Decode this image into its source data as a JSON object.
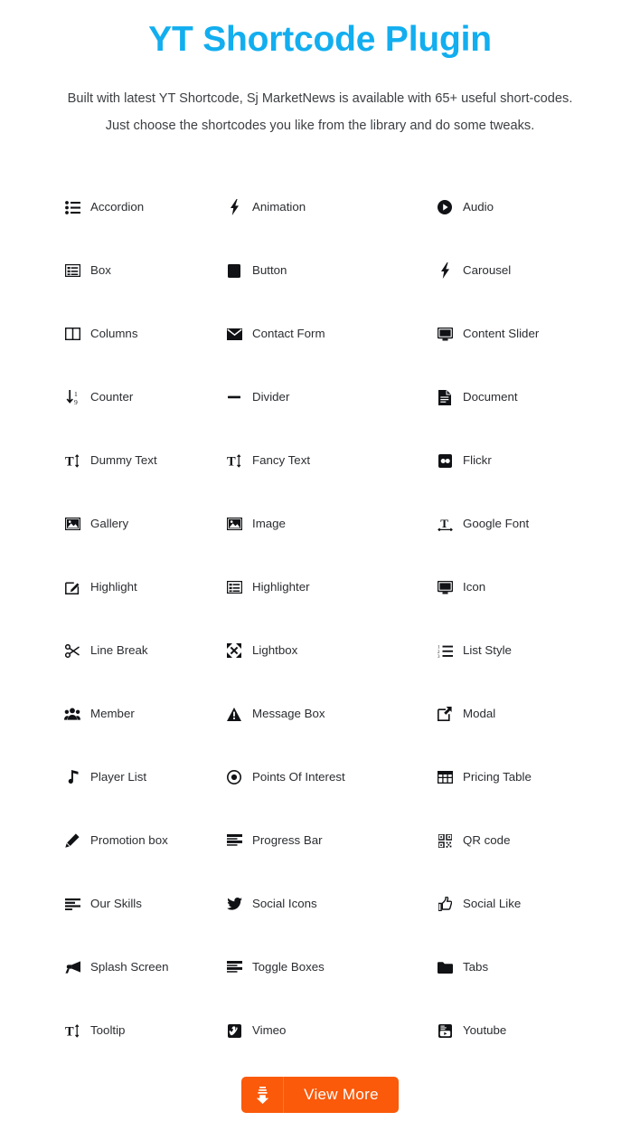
{
  "header": {
    "title": "YT Shortcode Plugin",
    "subtitle": "Built with latest YT Shortcode, Sj MarketNews is available with 65+ useful short-codes.  Just choose the shortcodes you like from the library and do some tweaks.",
    "title_color": "#12AEEF",
    "subtitle_color": "#3d4044"
  },
  "shortcodes": {
    "rows": [
      [
        {
          "label": "Accordion",
          "icon": "list-ul-icon"
        },
        {
          "label": "Animation",
          "icon": "bolt-icon"
        },
        {
          "label": "Audio",
          "icon": "play-circle-icon"
        }
      ],
      [
        {
          "label": "Box",
          "icon": "list-alt-icon"
        },
        {
          "label": "Button",
          "icon": "square-filled-icon"
        },
        {
          "label": "Carousel",
          "icon": "bolt-icon"
        }
      ],
      [
        {
          "label": "Columns",
          "icon": "columns-icon"
        },
        {
          "label": "Contact Form",
          "icon": "envelope-icon"
        },
        {
          "label": "Content Slider",
          "icon": "desktop-icon"
        }
      ],
      [
        {
          "label": "Counter",
          "icon": "sort-numeric-icon"
        },
        {
          "label": "Divider",
          "icon": "minus-icon"
        },
        {
          "label": "Document",
          "icon": "file-text-icon"
        }
      ],
      [
        {
          "label": "Dummy Text",
          "icon": "text-height-icon"
        },
        {
          "label": "Fancy Text",
          "icon": "text-height-icon"
        },
        {
          "label": "Flickr",
          "icon": "flickr-icon"
        }
      ],
      [
        {
          "label": "Gallery",
          "icon": "picture-icon"
        },
        {
          "label": "Image",
          "icon": "picture-icon"
        },
        {
          "label": "Google Font",
          "icon": "text-width-icon"
        }
      ],
      [
        {
          "label": "Highlight",
          "icon": "pencil-square-icon"
        },
        {
          "label": "Highlighter",
          "icon": "list-alt-icon"
        },
        {
          "label": "Icon",
          "icon": "desktop-icon"
        }
      ],
      [
        {
          "label": "Line Break",
          "icon": "scissors-icon"
        },
        {
          "label": "Lightbox",
          "icon": "expand-arrows-icon"
        },
        {
          "label": "List Style",
          "icon": "list-ol-icon"
        }
      ],
      [
        {
          "label": "Member",
          "icon": "group-icon"
        },
        {
          "label": "Message Box",
          "icon": "warning-triangle-icon"
        },
        {
          "label": "Modal",
          "icon": "external-link-icon"
        }
      ],
      [
        {
          "label": "Player List",
          "icon": "music-note-icon"
        },
        {
          "label": "Points Of Interest",
          "icon": "dot-circle-icon"
        },
        {
          "label": "Pricing Table",
          "icon": "table-icon"
        }
      ],
      [
        {
          "label": "Promotion box",
          "icon": "pencil-icon"
        },
        {
          "label": "Progress Bar",
          "icon": "tasks-icon"
        },
        {
          "label": "QR code",
          "icon": "qrcode-icon"
        }
      ],
      [
        {
          "label": "Our Skills",
          "icon": "align-left-icon"
        },
        {
          "label": "Social Icons",
          "icon": "twitter-icon"
        },
        {
          "label": "Social Like",
          "icon": "thumbs-up-icon"
        }
      ],
      [
        {
          "label": "Splash Screen",
          "icon": "bullhorn-icon"
        },
        {
          "label": "Toggle Boxes",
          "icon": "tasks-icon"
        },
        {
          "label": "Tabs",
          "icon": "folder-icon"
        }
      ],
      [
        {
          "label": "Tooltip",
          "icon": "text-height-icon"
        },
        {
          "label": "Vimeo",
          "icon": "vimeo-icon"
        },
        {
          "label": "Youtube",
          "icon": "youtube-icon"
        }
      ]
    ]
  },
  "view_more": {
    "label": "View More",
    "icon": "download-arrow-icon",
    "background_color": "#FA5A0A",
    "text_color": "#FFFFFF"
  }
}
